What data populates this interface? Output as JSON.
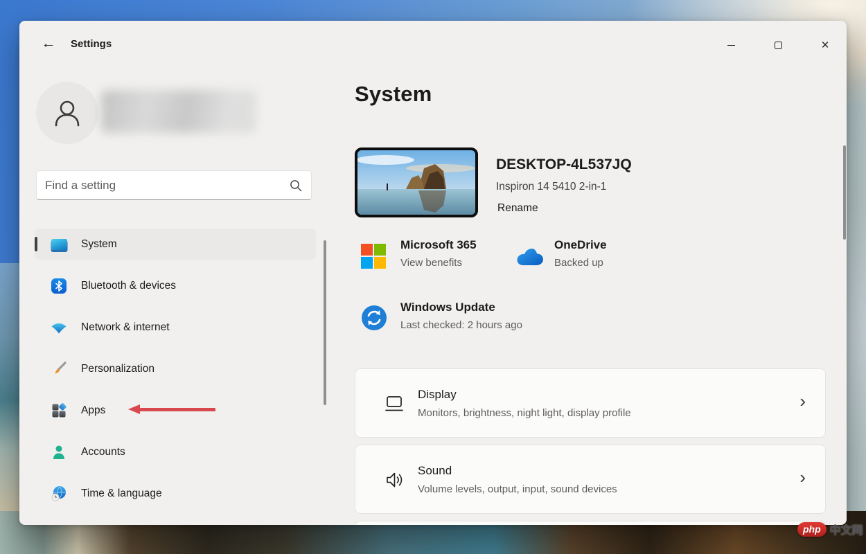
{
  "window": {
    "title": "Settings"
  },
  "sidebar": {
    "search_placeholder": "Find a setting",
    "items": [
      {
        "label": "System",
        "selected": true
      },
      {
        "label": "Bluetooth & devices"
      },
      {
        "label": "Network & internet"
      },
      {
        "label": "Personalization"
      },
      {
        "label": "Apps",
        "highlighted_by_arrow": true
      },
      {
        "label": "Accounts"
      },
      {
        "label": "Time & language"
      }
    ]
  },
  "main": {
    "page_title": "System",
    "device": {
      "name": "DESKTOP-4L537JQ",
      "model": "Inspiron 14 5410 2-in-1",
      "rename_label": "Rename"
    },
    "badges": [
      {
        "title": "Microsoft 365",
        "subtitle": "View benefits"
      },
      {
        "title": "OneDrive",
        "subtitle": "Backed up"
      },
      {
        "title": "Windows Update",
        "subtitle": "Last checked: 2 hours ago"
      }
    ],
    "cards": [
      {
        "title": "Display",
        "subtitle": "Monitors, brightness, night light, display profile"
      },
      {
        "title": "Sound",
        "subtitle": "Volume levels, output, input, sound devices"
      }
    ],
    "chevron_glyph": "›"
  },
  "icons": {
    "back": "arrow-left",
    "search": "magnifier",
    "system": "laptop",
    "bluetooth": "bluetooth-rune",
    "network": "wifi-fan",
    "personalization": "paintbrush",
    "apps": "app-grid-with-diamond",
    "accounts": "person",
    "time_language": "globe-clock",
    "microsoft365": "ms-four-squares",
    "onedrive": "cloud",
    "windows_update": "sync-circle",
    "display": "monitor-outline",
    "sound": "speaker-waves"
  },
  "colors": {
    "accent_blue": "#0b5fd0",
    "selected_bg": "#eae9e7",
    "red_arrow": "#d9484e",
    "ms_red": "#f25022",
    "ms_green": "#7fba00",
    "ms_blue": "#00a4ef",
    "ms_yellow": "#ffb900",
    "update_blue": "#1f7fd6",
    "accounts_teal": "#1fb28e"
  },
  "watermark": {
    "badge": "php",
    "text": "中文网"
  }
}
